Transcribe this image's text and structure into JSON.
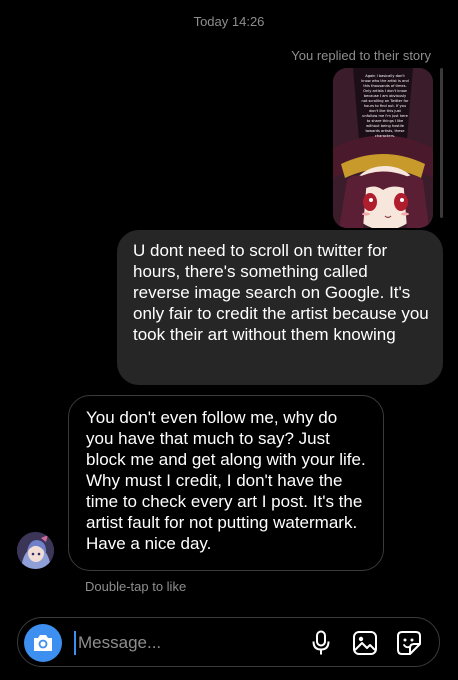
{
  "header": {
    "timestamp": "Today 14:26",
    "replied_label": "You replied to their story"
  },
  "story": {
    "overlay_text": "Again I basically don't know who the artist is and this thousands of times. Only artists I don't know because I am obviously not scrolling on Twitter for hours to find out. If you don't like this just unfollow me I'm just here to share things I like without being hostile towards artists, these characters."
  },
  "messages": {
    "sent": "U dont need to scroll on twitter for hours, there's something called reverse image search on Google. It's only fair to credit the artist because you took their art without them knowing",
    "received": "You don't even follow me, why do you have that much to say? Just block me and get along with your life. Why must I credit, I don't have the time to check every art I post. It's the artist fault for not putting watermark. Have a nice day.",
    "double_tap_hint": "Double-tap to like"
  },
  "composer": {
    "placeholder": "Message..."
  },
  "icons": {
    "camera": "camera-icon",
    "mic": "microphone-icon",
    "gallery": "gallery-icon",
    "sticker": "sticker-icon"
  },
  "colors": {
    "background": "#000000",
    "sent_bubble": "#262626",
    "accent": "#3d8ff0",
    "muted_text": "#8e8e8e"
  }
}
